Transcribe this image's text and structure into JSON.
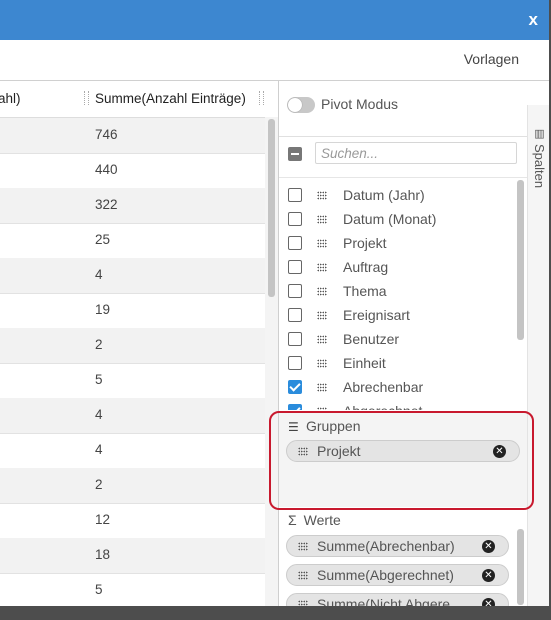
{
  "dialog": {
    "close_label": "x",
    "toolbar": {
      "vorlagen": "Vorlagen"
    }
  },
  "grid": {
    "headers": [
      "ahl)",
      "Summe(Anzahl Einträge)"
    ],
    "rows": [
      "746",
      "440",
      "322",
      "25",
      "4",
      "19",
      "2",
      "5",
      "4",
      "4",
      "2",
      "12",
      "18",
      "5"
    ]
  },
  "panel": {
    "pivot_label": "Pivot Modus",
    "search_placeholder": "Suchen...",
    "columns": [
      {
        "label": "Datum (Jahr)",
        "checked": false
      },
      {
        "label": "Datum (Monat)",
        "checked": false
      },
      {
        "label": "Projekt",
        "checked": false
      },
      {
        "label": "Auftrag",
        "checked": false
      },
      {
        "label": "Thema",
        "checked": false
      },
      {
        "label": "Ereignisart",
        "checked": false
      },
      {
        "label": "Benutzer",
        "checked": false
      },
      {
        "label": "Einheit",
        "checked": false
      },
      {
        "label": "Abrechenbar",
        "checked": true
      },
      {
        "label": "Abgerechnet",
        "checked": true
      }
    ],
    "groups_title": "Gruppen",
    "groups": [
      "Projekt"
    ],
    "values_title": "Werte",
    "values": [
      "Summe(Abrechenbar)",
      "Summe(Abgerechnet)",
      "Summe(Nicht Abgere"
    ]
  },
  "side_tab": {
    "label": "Spalten"
  },
  "colors": {
    "titlebar": "#3d87d0",
    "checkbox_on": "#2a8cdc",
    "highlight": "#c8192e"
  }
}
